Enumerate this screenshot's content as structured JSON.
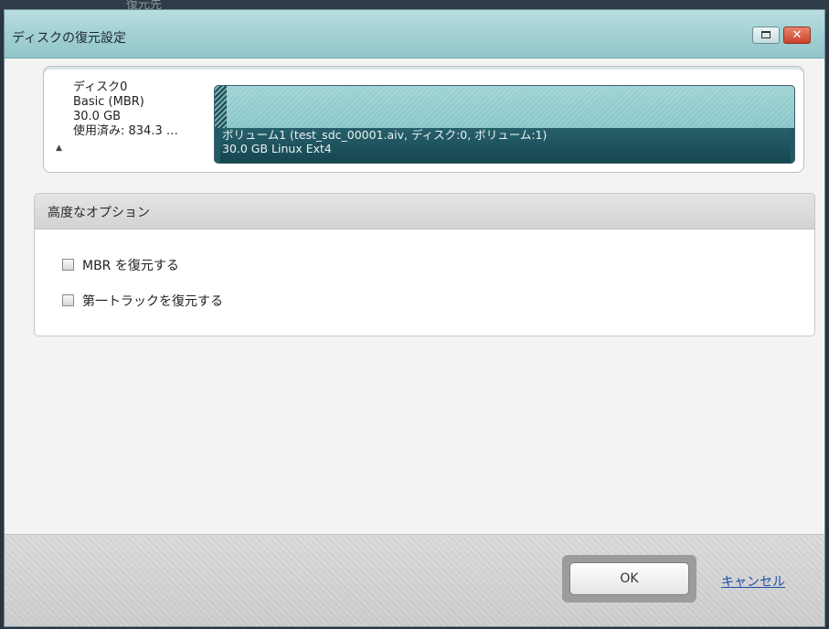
{
  "background": {
    "text": "復元先"
  },
  "window": {
    "title": "ディスクの復元設定",
    "buttons": {
      "restore_icon": "restore-window-icon",
      "close_label": "✕"
    }
  },
  "disk": {
    "name": "ディスク0",
    "scheme": "Basic (MBR)",
    "size": "30.0 GB",
    "used": "使用済み: 834.3 …",
    "collapse_icon": "▲",
    "volume": {
      "title": "ボリューム1  (test_sdc_00001.aiv, ディスク:0, ボリューム:1)",
      "detail": "30.0 GB Linux Ext4"
    }
  },
  "advanced": {
    "header": "高度なオプション",
    "options": [
      {
        "label": "MBR を復元する",
        "checked": false
      },
      {
        "label": "第一トラックを復元する",
        "checked": false
      }
    ]
  },
  "footer": {
    "ok_label": "OK",
    "cancel_label": "キャンセル"
  },
  "colors": {
    "titlebar": "#a1cfd3",
    "volume_bar": "#205a63",
    "cancel_link": "#1f4fa6"
  }
}
